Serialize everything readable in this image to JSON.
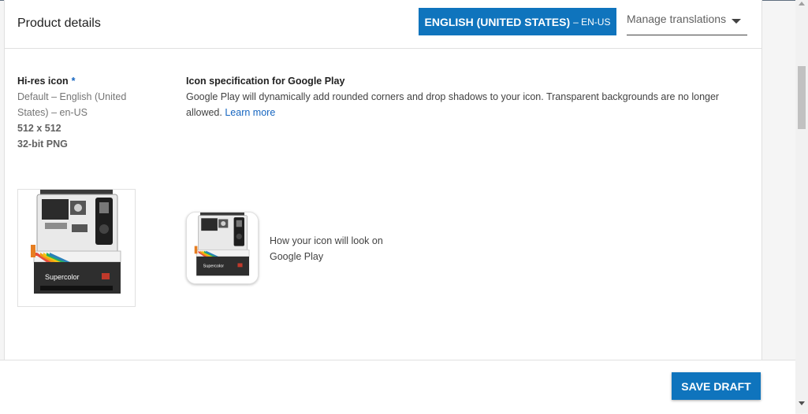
{
  "header": {
    "title": "Product details",
    "language_label": "ENGLISH (UNITED STATES)",
    "language_code": "– EN-US",
    "manage_label": "Manage translations"
  },
  "hires": {
    "label": "Hi-res icon",
    "required_mark": "*",
    "default_line": "Default – English (United States) – en-US",
    "size": "512 x 512",
    "format": "32-bit PNG"
  },
  "spec": {
    "title": "Icon specification for Google Play",
    "text": "Google Play will dynamically add rounded corners and drop shadows to your icon. Transparent backgrounds are no longer allowed.",
    "learn_more": "Learn more"
  },
  "preview": {
    "text": "How your icon will look on Google Play",
    "camera_brand": "Supercolor"
  },
  "footer": {
    "save_label": "SAVE DRAFT"
  },
  "colors": {
    "accent": "#0f74bd",
    "link": "#1565c0"
  }
}
